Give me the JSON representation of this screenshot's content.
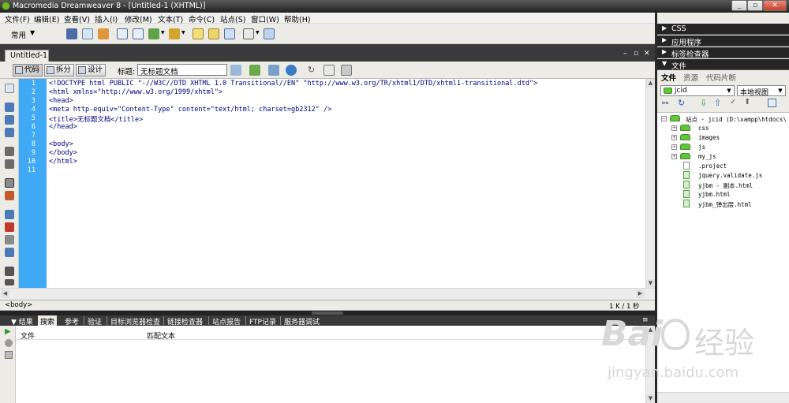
{
  "window": {
    "title": "Macromedia Dreamweaver 8 - [Untitled-1 (XHTML)]",
    "controls": [
      "_",
      "▫",
      "✕"
    ]
  },
  "menu": [
    "文件(F)",
    "编辑(E)",
    "查看(V)",
    "插入(I)",
    "修改(M)",
    "文本(T)",
    "命令(C)",
    "站点(S)",
    "窗口(W)",
    "帮助(H)"
  ],
  "insert_toolbar": {
    "category": "常用"
  },
  "document": {
    "tab": "Untitled-1",
    "view_buttons": {
      "code": "代码",
      "split": "拆分",
      "design": "设计"
    },
    "title_label": "标题:",
    "title_value": "无标题文档"
  },
  "editor": {
    "line_numbers": [
      "1",
      "2",
      "3",
      "4",
      "5",
      "6",
      "7",
      "8",
      "9",
      "10",
      "11"
    ],
    "code_lines": [
      "<!DOCTYPE html PUBLIC \"-//W3C//DTD XHTML 1.0 Transitional//EN\" \"http://www.w3.org/TR/xhtml1/DTD/xhtml1-transitional.dtd\">",
      "<html xmlns=\"http://www.w3.org/1999/xhtml\">",
      "<head>",
      "<meta http-equiv=\"Content-Type\" content=\"text/html; charset=gb2312\" />",
      "<title>无标题文档</title>",
      "</head>",
      "",
      "<body>",
      "</body>",
      "</html>",
      ""
    ]
  },
  "status_bar": {
    "tag": "<body>",
    "size": "1 K / 1 秒"
  },
  "results_panel": {
    "title": "结果",
    "tabs": [
      "搜索",
      "参考",
      "验证",
      "目标浏览器检查",
      "链接检查器",
      "站点报告",
      "FTP记录",
      "服务器调试"
    ],
    "columns": [
      "文件",
      "匹配文本"
    ]
  },
  "right_panels": {
    "collapsed": [
      "CSS",
      "应用程序",
      "标签检查器"
    ],
    "files_panel_title": "文件",
    "tabs": [
      "文件",
      "资源",
      "代码片断"
    ],
    "site_select": "jcid",
    "view_select": "本地视图",
    "tree_root": "站点 - jcid (D:\\xampp\\htdocs\\",
    "tree_items": [
      {
        "name": "css",
        "kind": "folder"
      },
      {
        "name": "images",
        "kind": "folder"
      },
      {
        "name": "js",
        "kind": "folder"
      },
      {
        "name": "my_js",
        "kind": "folder"
      },
      {
        "name": ".project",
        "kind": "file"
      },
      {
        "name": "jquery.validate.js",
        "kind": "script"
      },
      {
        "name": "yjbm - 副本.html",
        "kind": "html"
      },
      {
        "name": "yjbm.html",
        "kind": "html"
      },
      {
        "name": "yjbm_弹出层.html",
        "kind": "html"
      }
    ]
  },
  "watermark": {
    "brand": "Bai",
    "brand2": "经验",
    "url": "jingyan.baidu.com"
  },
  "colors": {
    "gutter": "#3fa9f5",
    "code_text": "#000080",
    "dark_chrome": "#3a3a3a",
    "panel_bg": "#ecebe6"
  }
}
